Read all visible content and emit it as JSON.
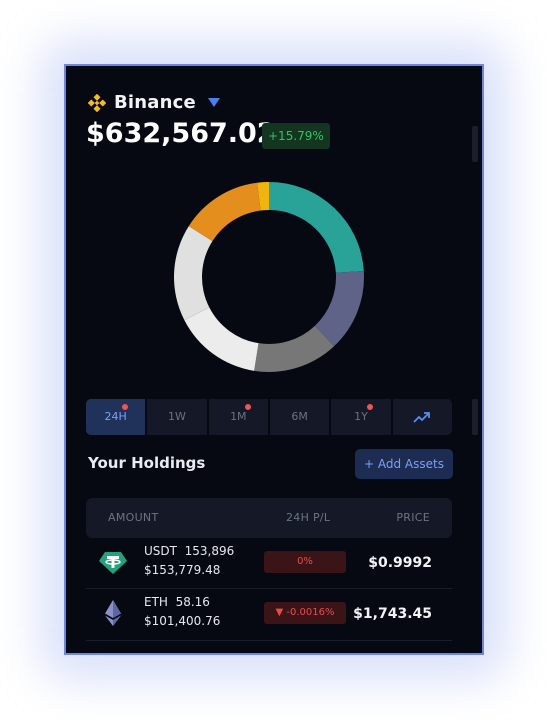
{
  "exchange": {
    "name": "Binance",
    "logo_icon": "binance-diamond-icon",
    "accent": "#f3ba2f"
  },
  "balance": {
    "value": "$632,567.02",
    "change": "+15.79%",
    "change_color": "#32c265"
  },
  "allocation": {
    "segments": [
      {
        "label": "teal",
        "value": 24.0,
        "color": "#29a397"
      },
      {
        "label": "slate",
        "value": 14.0,
        "color": "#5f6388"
      },
      {
        "label": "gray",
        "value": 14.5,
        "color": "#777777"
      },
      {
        "label": "white",
        "value": 15.0,
        "color": "#ececec"
      },
      {
        "label": "light gray",
        "value": 16.5,
        "color": "#e0e0e0"
      },
      {
        "label": "orange",
        "value": 14.0,
        "color": "#e48f1d"
      },
      {
        "label": "yellow",
        "value": 2.0,
        "color": "#f0b40e"
      }
    ]
  },
  "periods": {
    "tabs": [
      {
        "label": "24H",
        "active": true,
        "dot": true
      },
      {
        "label": "1W",
        "active": false,
        "dot": false
      },
      {
        "label": "1M",
        "active": false,
        "dot": true
      },
      {
        "label": "6M",
        "active": false,
        "dot": false
      },
      {
        "label": "1Y",
        "active": false,
        "dot": true
      }
    ],
    "chart_icon": "trending-up-icon"
  },
  "holdings": {
    "title": "Your Holdings",
    "add_button": "+ Add Assets",
    "columns": {
      "amount": "AMOUNT",
      "pl": "24H P/L",
      "price": "PRICE"
    },
    "rows": [
      {
        "symbol": "USDT",
        "quantity": "153,896",
        "value": "$153,779.48",
        "pl": "0%",
        "price": "$0.9992",
        "icon": "tether-icon"
      },
      {
        "symbol": "ETH",
        "quantity": "58.16",
        "value": "$101,400.76",
        "pl": "▼ -0.0016%",
        "price": "$1,743.45",
        "icon": "ethereum-icon"
      }
    ]
  }
}
